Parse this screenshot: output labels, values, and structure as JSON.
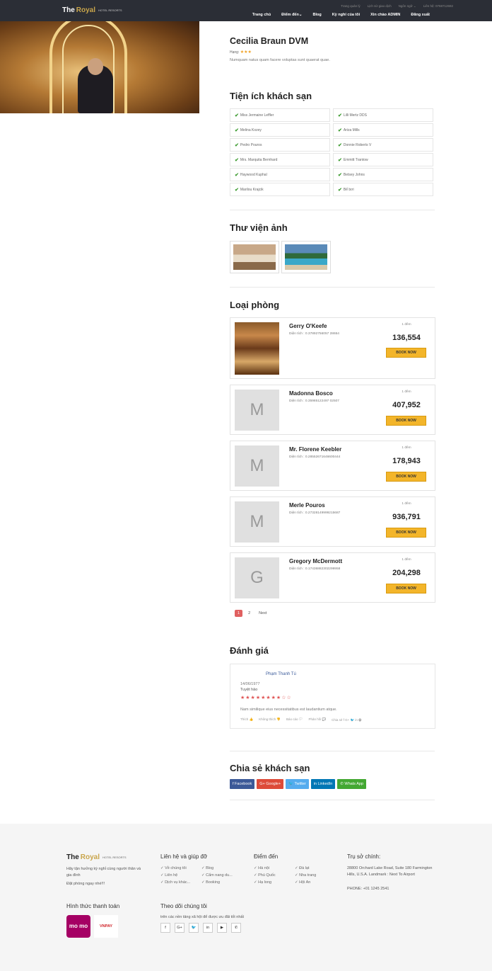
{
  "header": {
    "logo_main": "The",
    "logo_accent": "Royal",
    "logo_sub": "HOTEL RESORTS",
    "util": [
      "Trang quản lý",
      "Lịch sử giao dịch",
      "Ngôn ngữ ⌄",
      "Liên hệ: 0768712692"
    ],
    "nav": [
      "Trang chủ",
      "Điểm đến⌄",
      "Blog",
      "Kỳ nghỉ của tôi",
      "Xin chào ADMIN",
      "Đăng xuất"
    ]
  },
  "hotel": {
    "name": "Cecilia Braun DVM",
    "rating_label": "Hạng:",
    "stars": "★★★",
    "description": "Numquam natus quam facere voluptas sunt quaerat quae."
  },
  "amenities": {
    "title": "Tiện ích khách sạn",
    "items": [
      "Miss Jermaine Leffler",
      "Lilli Mertz DDS",
      "Melina Kozey",
      "Ariza Mills",
      "Pedro Pouros",
      "Donnie Roberts V",
      "Mrs. Marquita Bernhard",
      "Emmitt Trantow",
      "Haywood Kuphal",
      "Betsey Johns",
      "Marilou Krajcik",
      "Bể bơi"
    ]
  },
  "gallery": {
    "title": "Thư viện ảnh"
  },
  "rooms": {
    "title": "Loại phòng",
    "per_night": "1 đêm",
    "book_label": "BOOK NOW",
    "items": [
      {
        "name": "Gerry O'Keefe",
        "area": "Diện tích : 0.37892756057 28654",
        "price": "136,554",
        "initial": ""
      },
      {
        "name": "Madonna Bosco",
        "area": "Diện tích : 0.35985122497 02507",
        "price": "407,952",
        "initial": "M"
      },
      {
        "name": "Mr. Florene Keebler",
        "area": "Diện tích : 0.28552671646600444",
        "price": "178,943",
        "initial": "M"
      },
      {
        "name": "Merle Pouros",
        "area": "Diện tích : 0.27328149999215687",
        "price": "936,791",
        "initial": "M"
      },
      {
        "name": "Gregory McDermott",
        "area": "Diện tích : 0.17436882302299958",
        "price": "204,298",
        "initial": "G"
      }
    ]
  },
  "pagination": {
    "pages": [
      "1",
      "2"
    ],
    "next": "Next"
  },
  "reviews": {
    "title": "Đánh giá",
    "author": "Phạm Thanh Tú",
    "date": "14/06/1977",
    "headline": "Tuyệt hảo",
    "stars": "★★★★★★★★☆☆",
    "text": "Nam similique eius necessitatibus est laudantium atque.",
    "actions": [
      "Thích 👍",
      "Không thích 👎",
      "Báo cáo 🏳",
      "Phản hồi 💬",
      "Chia sẻ  f  G+  🐦  in  🖶"
    ]
  },
  "share": {
    "title": "Chia sẻ khách sạn",
    "buttons": [
      {
        "label": "f Facebook",
        "color": "#3b5998"
      },
      {
        "label": "G+ Google+",
        "color": "#dd4b39"
      },
      {
        "label": "🐦 Twitter",
        "color": "#55acee"
      },
      {
        "label": "in LinkedIn",
        "color": "#0077b5"
      },
      {
        "label": "✆ Whats App",
        "color": "#43a832"
      }
    ]
  },
  "footer": {
    "logo_main": "The",
    "logo_accent": "Royal",
    "logo_sub": "HOTEL RESORTS",
    "tagline": "Hãy tận hưởng kỳ nghỉ cùng người thân và gia đình",
    "book_now": "Đặt phòng ngay nhé!!!",
    "contact_title": "Liên hệ và giúp đỡ",
    "contact_links": [
      "✓ Về chúng tôi",
      "✓ Blog",
      "✓ Liên hệ",
      "✓ Cẩm nang du...",
      "✓ Dịch vụ khác...",
      "✓ Booking"
    ],
    "dest_title": "Điểm đến",
    "dest_links": [
      "✓ Hà nội",
      "✓ Đà lạt",
      "✓ Phú Quốc",
      "✓ Nha trang",
      "✓ Hạ long",
      "✓ Hội An"
    ],
    "hq_title": "Trụ sở chính:",
    "hq_address": "28800 Orchard Lake Road, Suite 180 Farmington Hills, U.S.A. Landmark : Next To Airport",
    "hq_phone": "PHONE: +01 1245 2541",
    "pay_title": "Hình thức thanh toán",
    "momo": "mo mo",
    "vnpay": "VNPAY",
    "follow_title": "Theo dõi chúng tôi",
    "follow_sub": "trên các nền tảng xã hội để được ưu đãi tốt nhất",
    "social": [
      "f",
      "G+",
      "🐦",
      "in",
      "▶",
      "✆"
    ]
  }
}
